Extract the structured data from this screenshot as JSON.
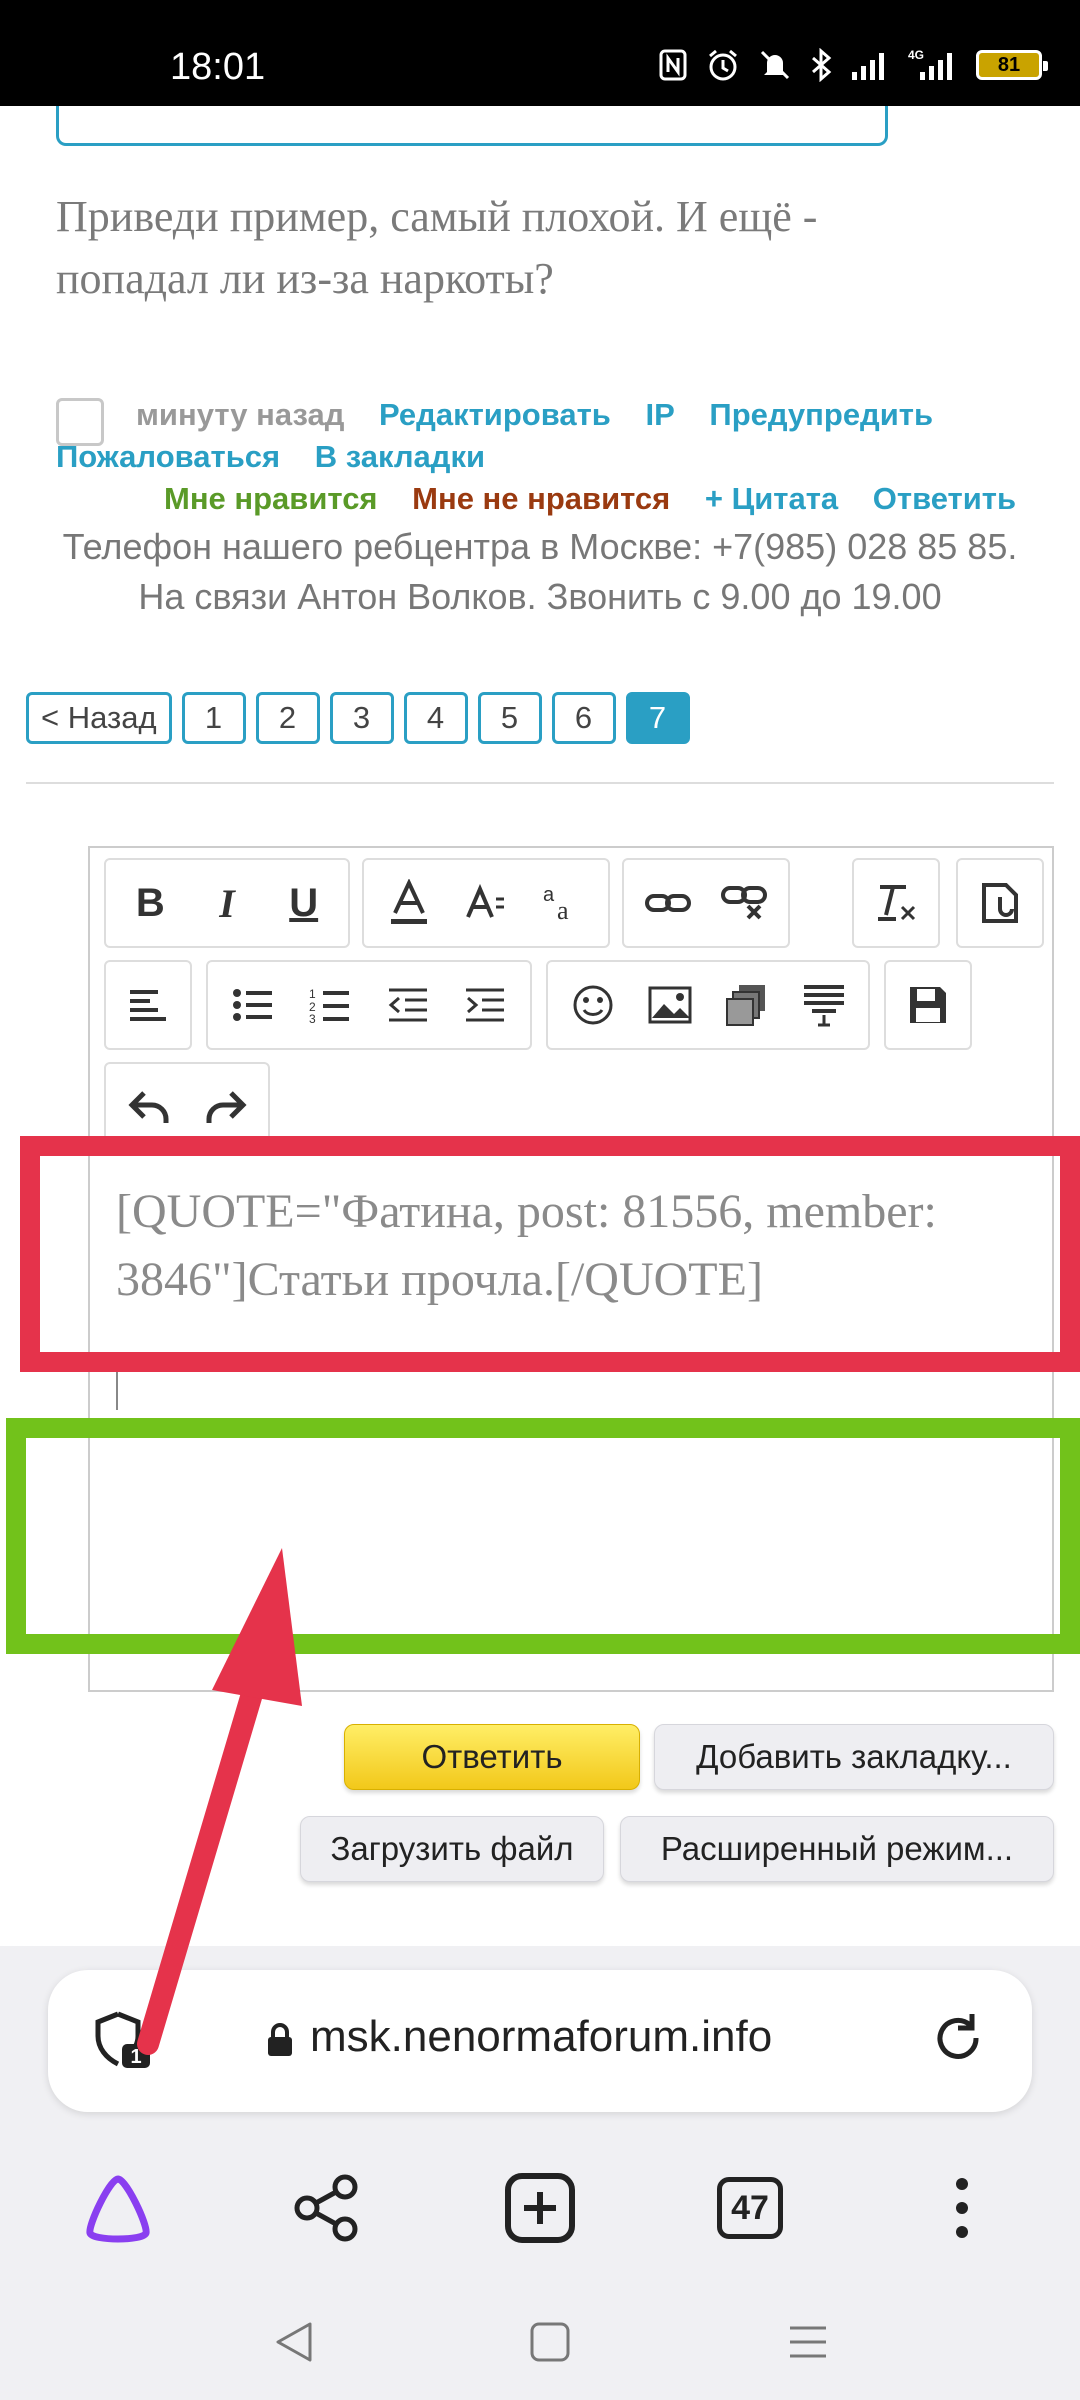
{
  "status_bar": {
    "time": "18:01",
    "battery": "81",
    "network": "4G"
  },
  "post": {
    "text": "Приведи пример, самый плохой. И ещё - попадал ли из-за наркоты?",
    "time_ago": "минуту назад",
    "actions_row1": [
      "Редактировать",
      "IP",
      "Предупредить"
    ],
    "actions_row2": [
      "Пожаловаться",
      "В закладки"
    ],
    "like": "Мне нравится",
    "dislike": "Мне не нравится",
    "quote": "+ Цитата",
    "reply": "Ответить",
    "signature": "Телефон нашего ребцентра в Москве: +7(985) 028 85 85. На связи Антон Волков. Звонить с 9.00 до 19.00"
  },
  "pagination": {
    "back": "< Назад",
    "pages": [
      "1",
      "2",
      "3",
      "4",
      "5",
      "6",
      "7"
    ],
    "current": "7"
  },
  "editor": {
    "content": "[QUOTE=\"Фатина, post: 81556, member: 3846\"]Статьи прочла.[/QUOTE]",
    "toolbar": {
      "bold": "B",
      "italic": "I",
      "underline": "U"
    }
  },
  "form_buttons": {
    "reply": "Ответить",
    "add_bookmark": "Добавить закладку...",
    "upload": "Загрузить файл",
    "advanced": "Расширенный режим..."
  },
  "browser": {
    "url": "msk.nenormaforum.info",
    "shield_count": "1",
    "tabs_count": "47"
  },
  "colors": {
    "accent": "#2a9fc4",
    "annotation_red": "#e5334b",
    "annotation_green": "#72c21b",
    "like_green": "#5a9a28",
    "dislike_brown": "#9a3a10",
    "reply_yellow": "#f7d730"
  }
}
